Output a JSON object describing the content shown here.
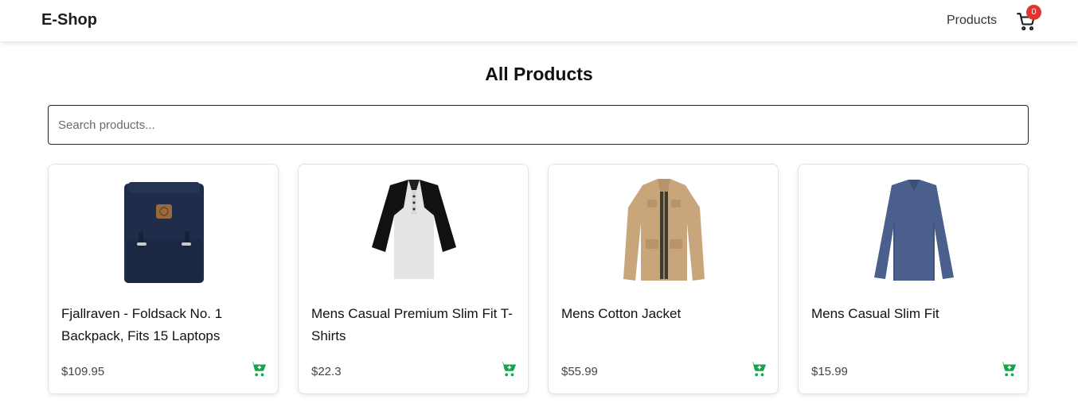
{
  "navbar": {
    "brand": "E-Shop",
    "products_link": "Products",
    "cart_count": "0",
    "cart_icon": "shopping-cart-icon"
  },
  "main": {
    "title": "All Products",
    "search": {
      "placeholder": "Search products...",
      "value": ""
    }
  },
  "products": [
    {
      "title": "Fjallraven - Foldsack No. 1 Backpack, Fits 15 Laptops",
      "price": "$109.95",
      "image": "backpack"
    },
    {
      "title": "Mens Casual Premium Slim Fit T-Shirts",
      "price": "$22.3",
      "image": "raglan-tshirt"
    },
    {
      "title": "Mens Cotton Jacket",
      "price": "$55.99",
      "image": "cotton-jacket"
    },
    {
      "title": "Mens Casual Slim Fit",
      "price": "$15.99",
      "image": "long-sleeve-shirt"
    }
  ],
  "colors": {
    "accent_green": "#16a34a",
    "badge_red": "#e5332f"
  }
}
